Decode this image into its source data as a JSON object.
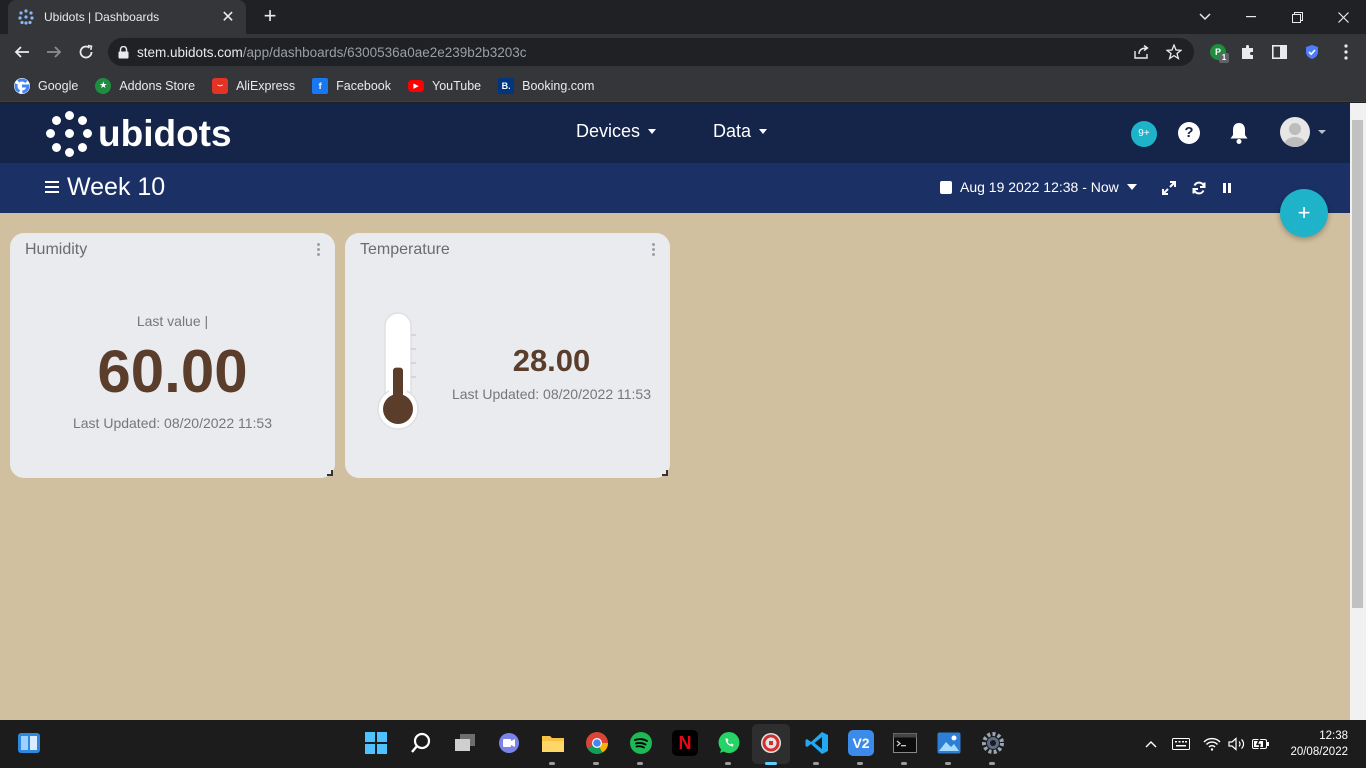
{
  "browser": {
    "tab_title": "Ubidots | Dashboards",
    "url_host": "stem.ubidots.com",
    "url_path": "/app/dashboards/6300536a0ae2e239b2b3203c",
    "bookmarks": [
      {
        "label": "Google",
        "icon": "google-icon",
        "color": "#ffffff"
      },
      {
        "label": "Addons Store",
        "icon": "addons-store-icon",
        "color": "#1e8e3e"
      },
      {
        "label": "AliExpress",
        "icon": "aliexpress-icon",
        "color": "#e43225"
      },
      {
        "label": "Facebook",
        "icon": "facebook-icon",
        "color": "#1877f2"
      },
      {
        "label": "YouTube",
        "icon": "youtube-icon",
        "color": "#ff0000"
      },
      {
        "label": "Booking.com",
        "icon": "booking-icon",
        "color": "#003580"
      }
    ],
    "extension_badge": "1"
  },
  "app": {
    "logo_text": "ubidots",
    "nav": {
      "devices": "Devices",
      "data": "Data"
    },
    "notifications_badge": "9+",
    "help_label": "?",
    "dashboard_title": "Week 10",
    "date_range": "Aug 19 2022 12:38 - Now",
    "fab_label": "+",
    "accent_color": "#1fb3c9",
    "background_color": "#d1c09f"
  },
  "widgets": {
    "humidity": {
      "title": "Humidity",
      "label": "Last value |",
      "value": "60.00",
      "updated": "Last Updated: 08/20/2022 11:53"
    },
    "temperature": {
      "title": "Temperature",
      "value": "28.00",
      "updated": "Last Updated: 08/20/2022 11:53",
      "thermometer_level": 0.45
    }
  },
  "taskbar": {
    "time": "12:38",
    "date": "20/08/2022"
  }
}
